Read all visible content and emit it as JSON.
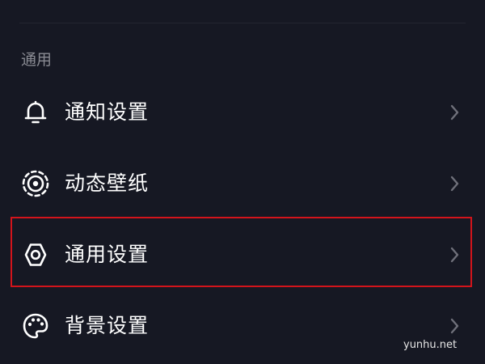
{
  "section": {
    "title": "通用"
  },
  "items": [
    {
      "label": "通知设置",
      "icon": "bell-icon"
    },
    {
      "label": "动态壁纸",
      "icon": "live-wallpaper-icon"
    },
    {
      "label": "通用设置",
      "icon": "gear-icon",
      "highlighted": true
    },
    {
      "label": "背景设置",
      "icon": "palette-icon"
    }
  ],
  "watermark": "yunhu.net",
  "colors": {
    "background": "#161823",
    "section_title": "#8a8b93",
    "label": "#ffffff",
    "chevron": "#6f707a",
    "highlight_border": "#d3141b"
  }
}
